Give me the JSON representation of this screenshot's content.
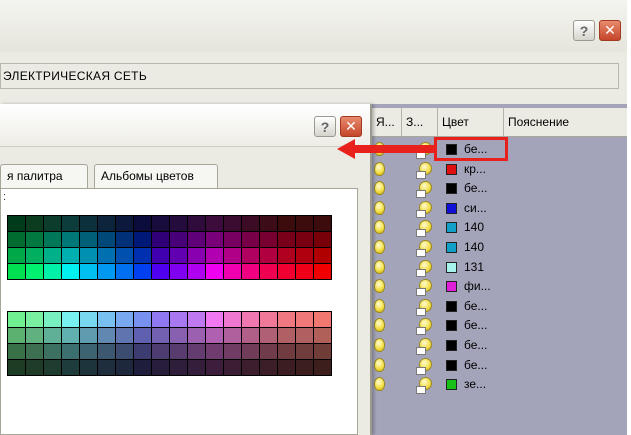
{
  "outer_dialog": {
    "help_label": "?",
    "close_label": "✕",
    "layer_name": "ЭЛЕКТРИЧЕСКАЯ СЕТЬ"
  },
  "inner_dialog": {
    "help_label": "?",
    "close_label": "✕",
    "tabs": [
      {
        "label": "я палитра"
      },
      {
        "label": "Альбомы цветов"
      }
    ],
    "palette_colon": ":"
  },
  "layer_list": {
    "columns": [
      {
        "label": "Я..."
      },
      {
        "label": "З..."
      },
      {
        "label": "Цвет"
      },
      {
        "label": "Пояснение"
      }
    ],
    "rows": [
      {
        "color_hex": "#000000",
        "color_name": "бе..."
      },
      {
        "color_hex": "#e01010",
        "color_name": "кр..."
      },
      {
        "color_hex": "#000000",
        "color_name": "бе..."
      },
      {
        "color_hex": "#1010d8",
        "color_name": "си..."
      },
      {
        "color_hex": "#12a0c8",
        "color_name": "140"
      },
      {
        "color_hex": "#12a0c8",
        "color_name": "140"
      },
      {
        "color_hex": "#a8f2ee",
        "color_name": "131"
      },
      {
        "color_hex": "#e020d8",
        "color_name": "фи..."
      },
      {
        "color_hex": "#000000",
        "color_name": "бе..."
      },
      {
        "color_hex": "#000000",
        "color_name": "бе..."
      },
      {
        "color_hex": "#000000",
        "color_name": "бе..."
      },
      {
        "color_hex": "#000000",
        "color_name": "бе..."
      },
      {
        "color_hex": "#18c018",
        "color_name": "зе..."
      }
    ]
  },
  "highlight_color": "#e8211c",
  "palette_rows_top": [
    [
      "#003c1c",
      "#0c3c20",
      "#0c3c2c",
      "#0c3c3c",
      "#0c303c",
      "#0c243c",
      "#0c183c",
      "#0c0c3c",
      "#180c3c",
      "#240c3c",
      "#300c3c",
      "#3c0c3c",
      "#3c0c30",
      "#3c0c24",
      "#3c0c18",
      "#3c0c0c",
      "#3c0c0c",
      "#3c0c0c"
    ],
    [
      "#006c30",
      "#007840",
      "#007858",
      "#007878",
      "#006078",
      "#004878",
      "#003078",
      "#001878",
      "#300078",
      "#480078",
      "#600078",
      "#780078",
      "#780060",
      "#780048",
      "#780030",
      "#780018",
      "#780010",
      "#780008"
    ],
    [
      "#00a848",
      "#00b060",
      "#00b088",
      "#00b0b0",
      "#0090b0",
      "#0070b0",
      "#0050b0",
      "#0030b0",
      "#4000b0",
      "#6000b0",
      "#8800b0",
      "#b000b0",
      "#b00088",
      "#b00060",
      "#b00040",
      "#b00020",
      "#b00010",
      "#b00000"
    ],
    [
      "#00e050",
      "#00f070",
      "#00f0a8",
      "#00f0f0",
      "#00c0f0",
      "#0098f0",
      "#0070f0",
      "#0040f0",
      "#5000f0",
      "#8000f0",
      "#b000f0",
      "#f000f0",
      "#f000b0",
      "#f00080",
      "#f00050",
      "#f00030",
      "#f00018",
      "#f00000"
    ]
  ],
  "palette_rows_bottom": [
    [
      "#70f090",
      "#78f0a0",
      "#78f0c0",
      "#78f0f0",
      "#78d8f0",
      "#78c0f0",
      "#78a8f0",
      "#7890f0",
      "#9078f0",
      "#a878f0",
      "#c078f0",
      "#f078f0",
      "#f078d0",
      "#f078b0",
      "#f07898",
      "#f07880",
      "#f07878",
      "#f07870"
    ],
    [
      "#5cb070",
      "#60b080",
      "#60b098",
      "#60b0b0",
      "#609cb0",
      "#6088b0",
      "#6074b0",
      "#6060b0",
      "#7460b0",
      "#8860b0",
      "#9c60b0",
      "#b060b0",
      "#b0609c",
      "#b06088",
      "#b06074",
      "#b06064",
      "#b06060",
      "#b06058"
    ],
    [
      "#387048",
      "#3c7050",
      "#3c7060",
      "#3c7070",
      "#3c6470",
      "#3c5870",
      "#3c4c70",
      "#3c3c70",
      "#4c3c70",
      "#583c70",
      "#643c70",
      "#703c70",
      "#703c64",
      "#703c58",
      "#703c4c",
      "#703c40",
      "#703c3c",
      "#703c38"
    ],
    [
      "#1c3c24",
      "#1e3c28",
      "#1e3c30",
      "#1e3c3c",
      "#1e343c",
      "#1e2e3c",
      "#1e283c",
      "#1e1e3c",
      "#281e3c",
      "#2e1e3c",
      "#341e3c",
      "#3c1e3c",
      "#3c1e34",
      "#3c1e2e",
      "#3c1e28",
      "#3c1e22",
      "#3c1e1e",
      "#3c1e1c"
    ]
  ]
}
